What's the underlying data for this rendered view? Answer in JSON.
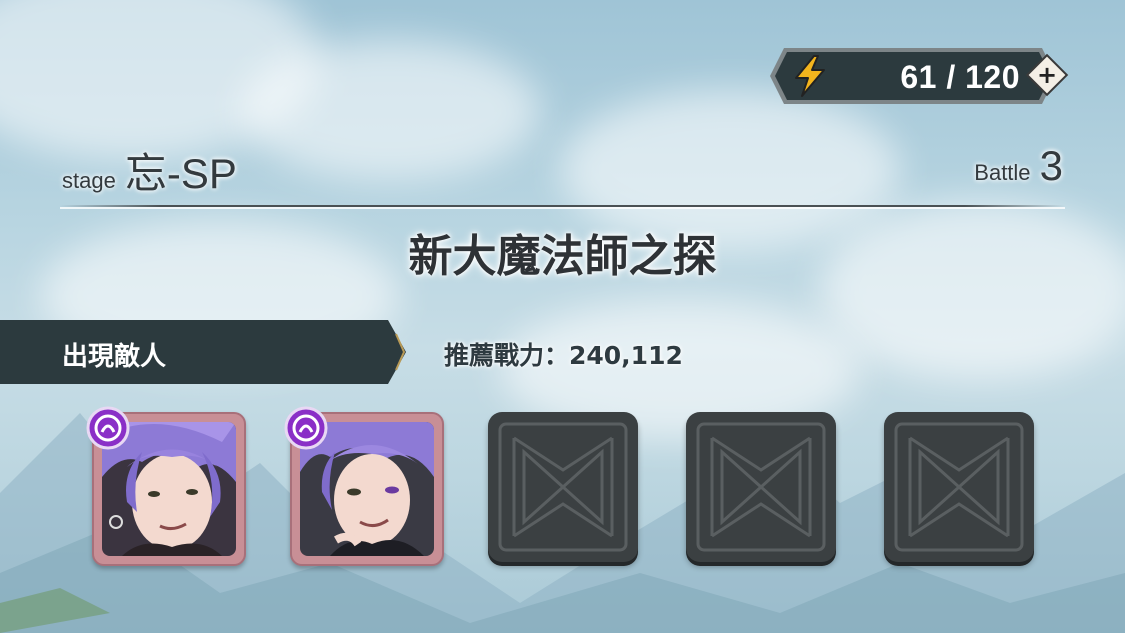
{
  "energy": {
    "current_max": "61 / 120",
    "plus": "+"
  },
  "stage": {
    "label": "stage",
    "code": "忘-SP"
  },
  "battle": {
    "label": "Battle",
    "number": "3"
  },
  "title": "新大魔法師之探",
  "enemies_tab": {
    "label": "出現敵人"
  },
  "recommended_power": "推薦戰力：240,112",
  "enemy_slots": [
    {
      "type": "enemy",
      "name": "enemy-portrait-1",
      "element_icon": "purple-magic-icon"
    },
    {
      "type": "enemy",
      "name": "enemy-portrait-2",
      "element_icon": "purple-magic-icon"
    },
    {
      "type": "empty"
    },
    {
      "type": "empty"
    },
    {
      "type": "empty"
    }
  ],
  "colors": {
    "accent_energy": "#f3b51d",
    "panel_dark": "#2c3a3e",
    "enemy_frame": "#c88f96",
    "element_badge": "#8a2fc7"
  }
}
